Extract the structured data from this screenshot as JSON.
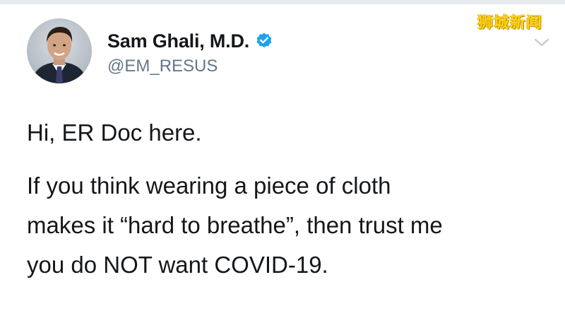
{
  "watermark": {
    "text": "狮城新闻"
  },
  "tweet": {
    "author": {
      "display_name": "Sam Ghali, M.D.",
      "handle": "@EM_RESUS",
      "verified": true,
      "verified_icon": "verified-badge-icon",
      "avatar_icon": "profile-photo"
    },
    "menu_icon": "chevron-down-icon",
    "body": {
      "line1": "Hi, ER Doc here.",
      "para2_lines": [
        "If you think wearing a piece of cloth",
        "makes it “hard to breathe”, then trust me",
        "you do NOT want COVID-19."
      ]
    }
  },
  "colors": {
    "text": "#14171a",
    "handle": "#657786",
    "verified_blue": "#1da1f2",
    "watermark": "#ffd21c"
  }
}
